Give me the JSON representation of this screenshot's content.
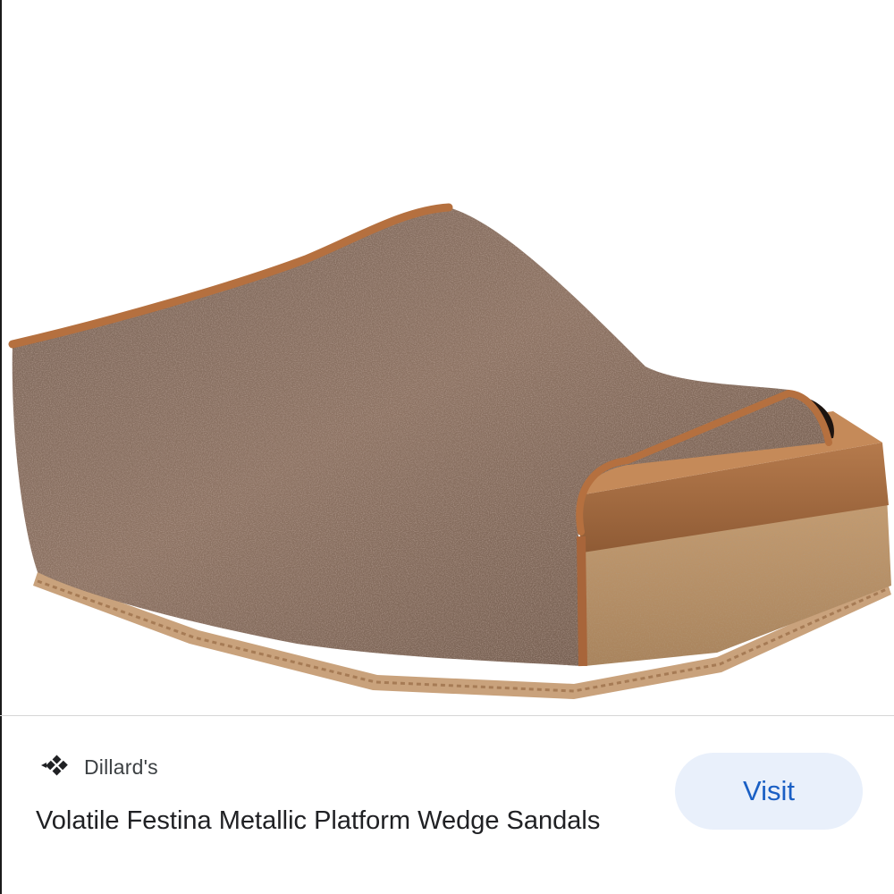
{
  "result": {
    "image_alt": "Volatile Festina Metallic Platform Wedge Sandals",
    "source": {
      "icon": "dillards-logo-icon",
      "name": "Dillard's"
    },
    "title": "Volatile Festina Metallic Platform Wedge Sandals",
    "visit_label": "Visit"
  },
  "colors": {
    "visit_bg": "#e9f0fb",
    "visit_text": "#1a5fc4",
    "metallic_upper": "#8a7060",
    "trim": "#b5703f",
    "cork": "#b8926a"
  }
}
